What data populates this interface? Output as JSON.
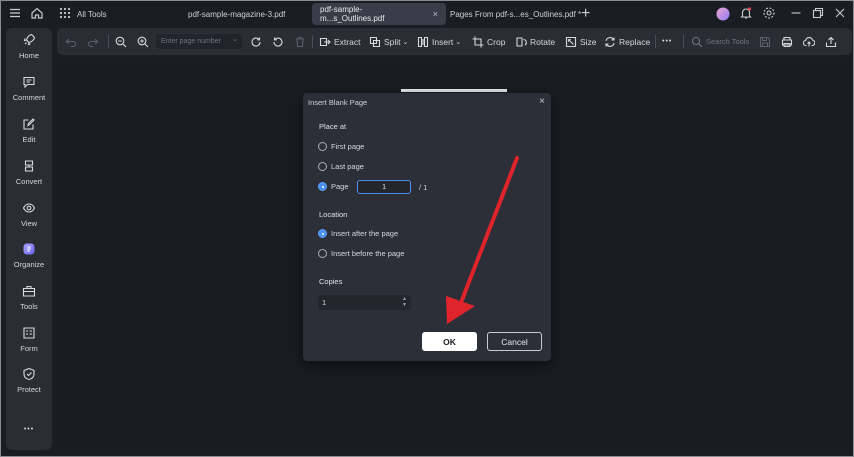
{
  "titlebar": {
    "all_tools": "All Tools",
    "tabs": [
      {
        "label": "pdf-sample-magazine-3.pdf",
        "active": false
      },
      {
        "label": "pdf-sample-m...s_Outlines.pdf",
        "active": true
      },
      {
        "label": "Pages From pdf-s...es_Outlines.pdf *",
        "active": false
      }
    ],
    "tab_close": "×",
    "new_tab": "+"
  },
  "sidebar": {
    "items": [
      {
        "label": "Home",
        "icon": "rocket-icon"
      },
      {
        "label": "Comment",
        "icon": "comment-icon"
      },
      {
        "label": "Edit",
        "icon": "edit-icon"
      },
      {
        "label": "Convert",
        "icon": "convert-icon"
      },
      {
        "label": "View",
        "icon": "eye-icon"
      },
      {
        "label": "Organize",
        "icon": "organize-icon"
      },
      {
        "label": "Tools",
        "icon": "toolbox-icon"
      },
      {
        "label": "Form",
        "icon": "form-icon"
      },
      {
        "label": "Protect",
        "icon": "shield-icon"
      }
    ],
    "more": "•••"
  },
  "toolbar": {
    "page_placeholder": "Enter page number",
    "extract": "Extract",
    "split": "Split",
    "insert": "Insert",
    "crop": "Crop",
    "rotate": "Rotate",
    "size": "Size",
    "replace": "Replace",
    "more": "•••",
    "search_tools": "Search Tools"
  },
  "dialog": {
    "title": "Insert Blank Page",
    "close": "×",
    "place_at_label": "Place at",
    "first_page": "First page",
    "last_page": "Last page",
    "page": "Page",
    "page_value": "1",
    "page_total": "/  1",
    "location_label": "Location",
    "insert_after": "Insert after the page",
    "insert_before": "Insert before the page",
    "copies_label": "Copies",
    "copies_value": "1",
    "ok": "OK",
    "cancel": "Cancel",
    "selected_place": "Page",
    "selected_location": "Insert after the page"
  },
  "colors": {
    "accent": "#4a8ef0",
    "arrow": "#e0242b",
    "background": "#1b1d24",
    "panel": "#2b2d35"
  }
}
